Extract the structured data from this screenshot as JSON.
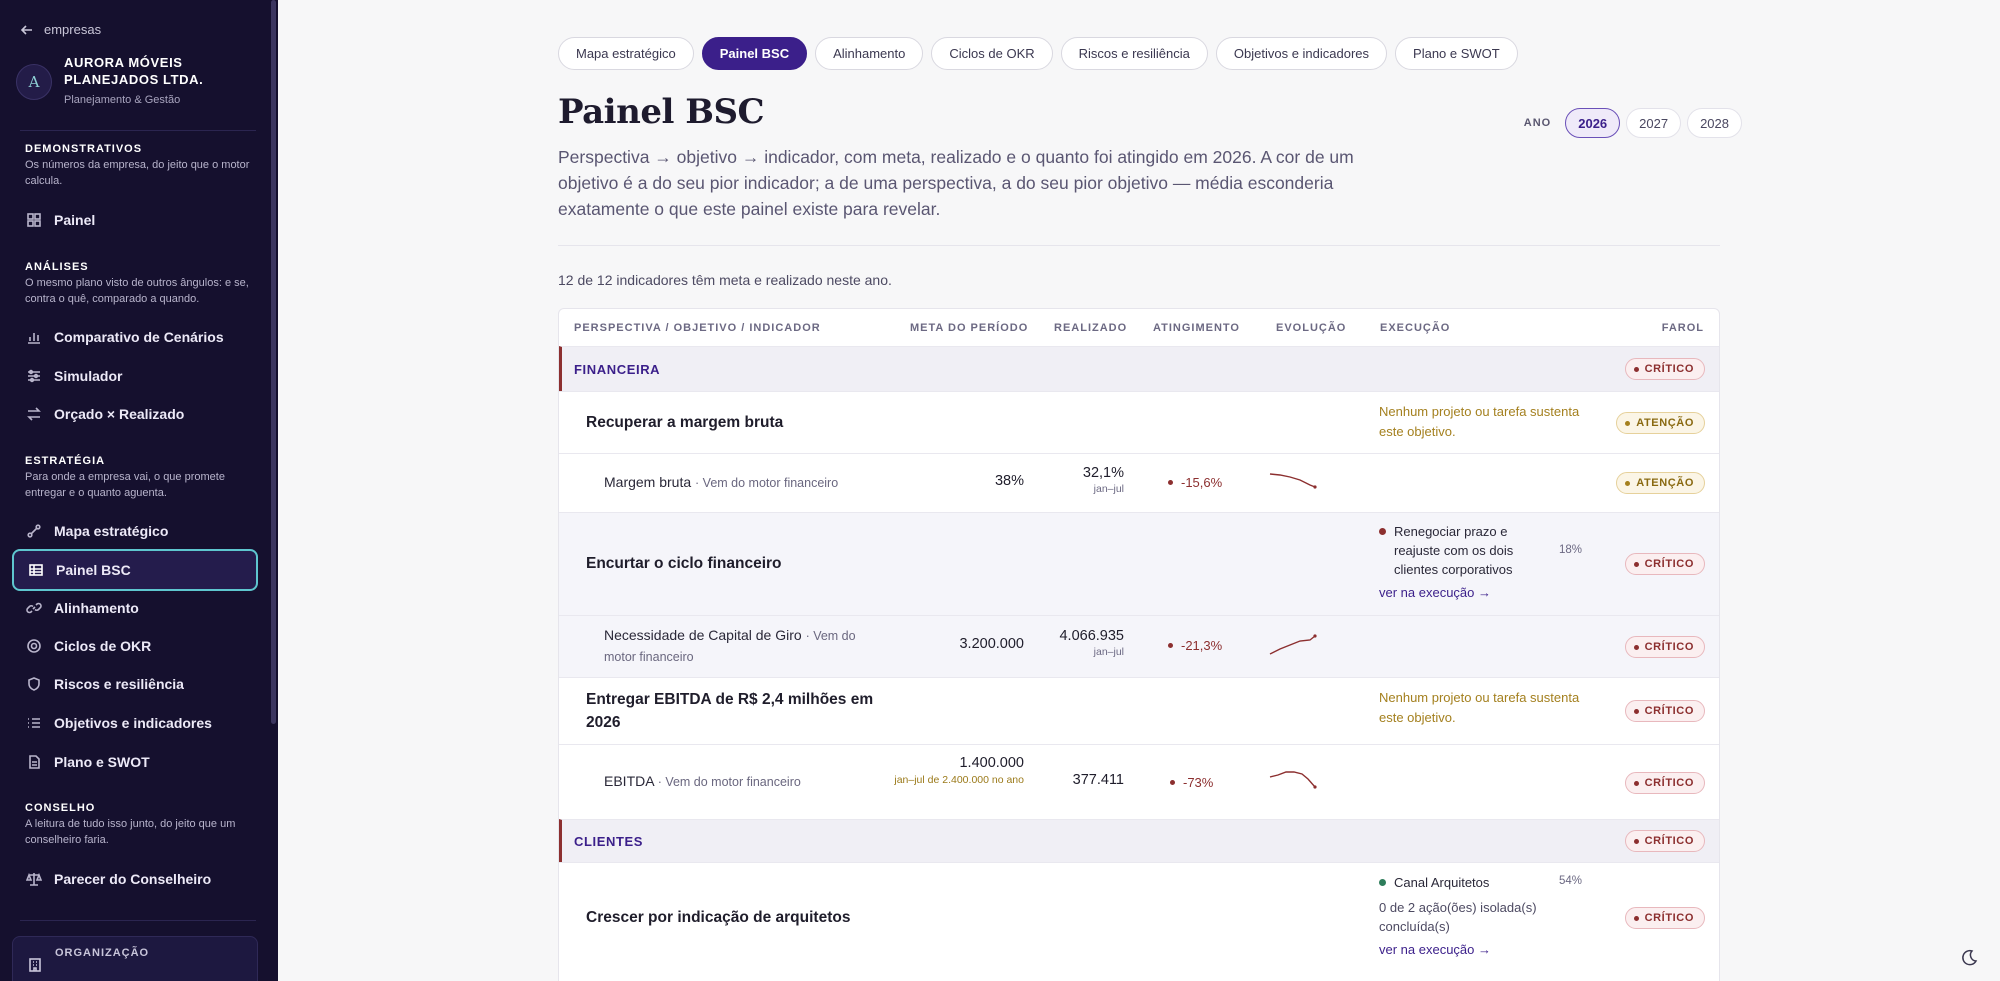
{
  "sidebar": {
    "back_label": "empresas",
    "company": {
      "initial": "A",
      "name": "AURORA MÓVEIS PLANEJADOS LTDA.",
      "subtitle": "Planejamento & Gestão"
    },
    "sections": [
      {
        "title": "DEMONSTRATIVOS",
        "desc": "Os números da empresa, do jeito que o motor calcula.",
        "items": [
          {
            "label": "Painel",
            "icon": "grid-icon"
          }
        ]
      },
      {
        "title": "ANÁLISES",
        "desc": "O mesmo plano visto de outros ângulos: e se, contra o quê, comparado a quando.",
        "items": [
          {
            "label": "Comparativo de Cenários",
            "icon": "bar-chart-icon"
          },
          {
            "label": "Simulador",
            "icon": "sliders-icon"
          },
          {
            "label": "Orçado × Realizado",
            "icon": "swap-arrows-icon"
          }
        ]
      },
      {
        "title": "ESTRATÉGIA",
        "desc": "Para onde a empresa vai, o que promete entregar e o quanto aguenta.",
        "items": [
          {
            "label": "Mapa estratégico",
            "icon": "route-icon"
          },
          {
            "label": "Painel BSC",
            "icon": "table-icon",
            "active": true
          },
          {
            "label": "Alinhamento",
            "icon": "link-icon"
          },
          {
            "label": "Ciclos de OKR",
            "icon": "target-icon"
          },
          {
            "label": "Riscos e resiliência",
            "icon": "shield-icon"
          },
          {
            "label": "Objetivos e indicadores",
            "icon": "list-icon"
          },
          {
            "label": "Plano e SWOT",
            "icon": "document-icon"
          }
        ]
      },
      {
        "title": "CONSELHO",
        "desc": "A leitura de tudo isso junto, do jeito que um conselheiro faria.",
        "items": [
          {
            "label": "Parecer do Conselheiro",
            "icon": "scale-icon"
          }
        ]
      }
    ],
    "org_label": "ORGANIZAÇÃO"
  },
  "tabs": [
    "Mapa estratégico",
    "Painel BSC",
    "Alinhamento",
    "Ciclos de OKR",
    "Riscos e resiliência",
    "Objetivos e indicadores",
    "Plano e SWOT"
  ],
  "page": {
    "title": "Painel BSC",
    "year_label": "ANO",
    "years": [
      "2026",
      "2027",
      "2028"
    ],
    "selected_year": "2026",
    "description": "Perspectiva → objetivo → indicador, com meta, realizado e o quanto foi atingido em 2026. A cor de um objetivo é a do seu pior indicador; a de uma perspectiva, a do seu pior objetivo — média esconderia exatamente o que este painel existe para revelar.",
    "count_text": "12 de 12 indicadores têm meta e realizado neste ano."
  },
  "table": {
    "headers": {
      "name": "PERSPECTIVA / OBJETIVO / INDICADOR",
      "meta": "META DO PERÍODO",
      "real": "REALIZADO",
      "atg": "ATINGIMENTO",
      "evo": "EVOLUÇÃO",
      "exec": "EXECUÇÃO",
      "farol": "FAROL"
    },
    "financeira": {
      "name": "FINANCEIRA",
      "farol": "CRÍTICO"
    },
    "obj1": {
      "name": "Recuperar a margem bruta",
      "exec_note": "Nenhum projeto ou tarefa sustenta este objetivo.",
      "farol": "ATENÇÃO"
    },
    "ind1": {
      "name": "Margem bruta",
      "source": "· Vem do motor financeiro",
      "meta": "38%",
      "real": "32,1%",
      "real_sub": "jan–jul",
      "atg": "-15,6%",
      "farol": "ATENÇÃO"
    },
    "obj2": {
      "name": "Encurtar o ciclo financeiro",
      "exec_item": "Renegociar prazo e reajuste com os dois clientes corporativos",
      "exec_pct": "18%",
      "exec_link": "ver na execução →",
      "farol": "CRÍTICO"
    },
    "ind2": {
      "name": "Necessidade de Capital de Giro",
      "source": "· Vem do motor financeiro",
      "meta": "3.200.000",
      "real": "4.066.935",
      "real_sub": "jan–jul",
      "atg": "-21,3%",
      "farol": "CRÍTICO"
    },
    "obj3": {
      "name": "Entregar EBITDA de R$ 2,4 milhões em 2026",
      "exec_note": "Nenhum projeto ou tarefa sustenta este objetivo.",
      "farol": "CRÍTICO"
    },
    "ind3": {
      "name": "EBITDA",
      "source": "· Vem do motor financeiro",
      "meta": "1.400.000",
      "meta_sub": "jan–jul de 2.400.000 no ano",
      "real": "377.411",
      "atg": "-73%",
      "farol": "CRÍTICO"
    },
    "clientes": {
      "name": "CLIENTES",
      "farol": "CRÍTICO"
    },
    "obj4": {
      "name": "Crescer por indicação de arquitetos",
      "exec_item": "Canal Arquitetos",
      "exec_pct": "54%",
      "exec_small": "0 de 2 ação(ões) isolada(s) concluída(s)",
      "exec_link": "ver na execução →",
      "farol": "CRÍTICO"
    }
  },
  "colors": {
    "critical": "#8c2f2f",
    "attention": "#a4801f",
    "accent": "#3b1f8a",
    "sidebar_bg": "#15102e",
    "active_outline": "#5ec6cf",
    "progress_ok": "#2e7d5b"
  }
}
